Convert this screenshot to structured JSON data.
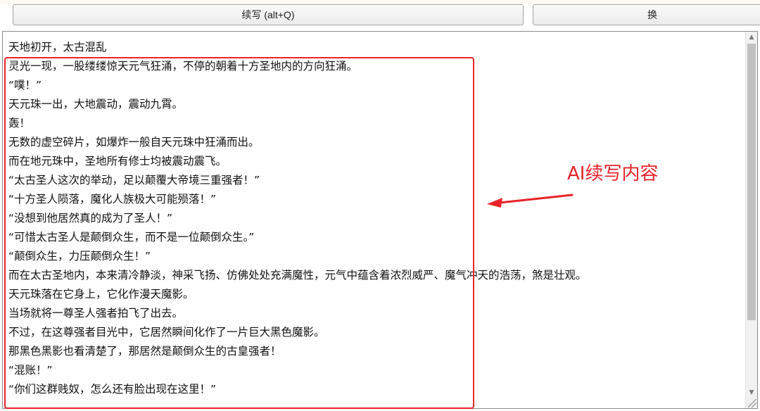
{
  "toolbar": {
    "continue_label": "续写 (alt+Q)",
    "switch_label": "换"
  },
  "editor": {
    "lines": [
      "天地初开，太古混乱",
      "灵光一现，一股缕缕惊天元气狂涌，不停的朝着十方圣地内的方向狂涌。",
      "“噗！”",
      "天元珠一出，大地震动，震动九霄。",
      "轰！",
      "无数的虚空碎片，如爆炸一般自天元珠中狂涌而出。",
      "而在地元珠中，圣地所有修士均被震动震飞。",
      "“太古圣人这次的举动，足以颠覆大帝境三重强者！”",
      "“十方圣人陨落，魔化人族极大可能殒落！”",
      "“没想到他居然真的成为了圣人！”",
      "“可惜太古圣人是颠倒众生，而不是一位颠倒众生。”",
      "“颠倒众生，力压颠倒众生！”",
      "而在太古圣地内，本来清冷静淡，神采飞扬、仿佛处处充满魔性，元气中蕴含着浓烈威严、魔气冲天的浩荡，煞是壮观。",
      "天元珠落在它身上，它化作漫天魔影。",
      "当场就将一尊圣人强者拍飞了出去。",
      "不过，在这尊强者目光中，它居然瞬间化作了一片巨大黑色魔影。",
      "那黑色黑影也看清楚了，那居然是颠倒众生的古皇强者！",
      "“混账！”",
      "“你们这群贱奴，怎么还有脸出现在这里！”"
    ]
  },
  "annotation": {
    "label": "AI续写内容",
    "color": "#e8232a"
  },
  "icons": {
    "scroll_up": "scroll-up-arrow-icon",
    "scroll_down": "scroll-down-arrow-icon",
    "annotation_arrow": "left-arrow-icon"
  }
}
